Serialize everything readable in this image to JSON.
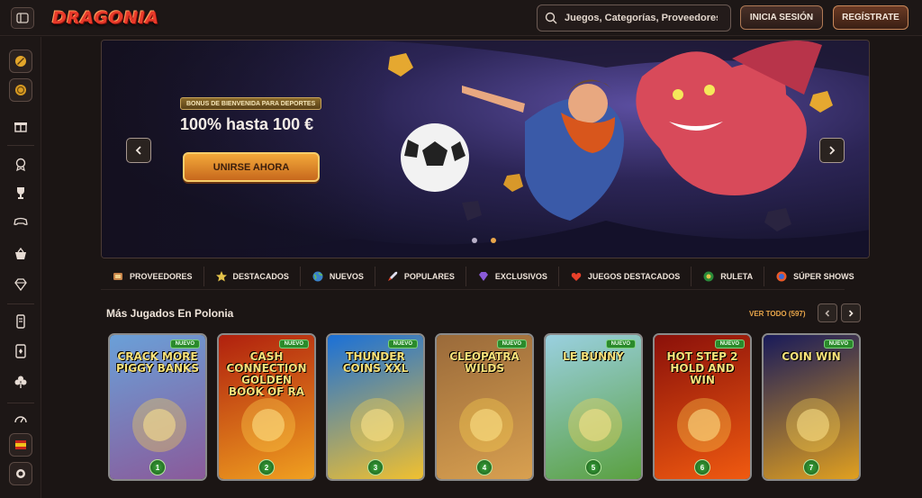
{
  "header": {
    "logo_text": "DRAGONIA",
    "search_placeholder": "Juegos, Categorías, Proveedores",
    "login_label": "INICIA SESIÓN",
    "register_label": "REGÍSTRATE"
  },
  "sidebar": {
    "icons": [
      "menu-icon",
      "rocket-icon",
      "coin-icon",
      "gift-icon",
      "medal-icon",
      "trophy-icon",
      "controller-icon",
      "basket-icon",
      "diamond-icon",
      "phone-icon",
      "card-icon",
      "clover-icon",
      "speed-icon",
      "flag-es-icon",
      "chip-icon"
    ]
  },
  "hero": {
    "tag": "BONUS DE BIENVENIDA PARA DEPORTES",
    "title": "100% hasta 100 €",
    "cta": "UNIRSE AHORA",
    "slides_total": 2,
    "active_slide": 1
  },
  "categories": [
    {
      "label": "PROVEEDORES",
      "icon": "providers-icon"
    },
    {
      "label": "DESTACADOS",
      "icon": "star-icon"
    },
    {
      "label": "NUEVOS",
      "icon": "globe-icon"
    },
    {
      "label": "POPULARES",
      "icon": "rocket-icon"
    },
    {
      "label": "EXCLUSIVOS",
      "icon": "gem-icon"
    },
    {
      "label": "JUEGOS DESTACADOS",
      "icon": "heart-icon"
    },
    {
      "label": "RULETA",
      "icon": "roulette-icon"
    },
    {
      "label": "SÚPER SHOWS",
      "icon": "show-icon"
    }
  ],
  "section": {
    "title": "Más Jugados En Polonia",
    "see_all": "VER TODO (597)"
  },
  "games": [
    {
      "title": "CRACK MORE PIGGY BANKS",
      "rank": "1",
      "badge": "NUEVO",
      "colors": [
        "#6aa0d8",
        "#8a5a9a"
      ]
    },
    {
      "title": "CASH CONNECTION GOLDEN BOOK OF RA",
      "rank": "2",
      "badge": "NUEVO",
      "colors": [
        "#b0200e",
        "#f0a020"
      ]
    },
    {
      "title": "THUNDER COINS XXL",
      "rank": "3",
      "badge": "NUEVO",
      "colors": [
        "#1a70d8",
        "#f0c030"
      ]
    },
    {
      "title": "CLEOPATRA WILDS",
      "rank": "4",
      "badge": "NUEVO",
      "colors": [
        "#9a6a3a",
        "#d8a050"
      ]
    },
    {
      "title": "LE BUNNY",
      "rank": "5",
      "badge": "NUEVO",
      "colors": [
        "#9ad0e0",
        "#5aa040"
      ]
    },
    {
      "title": "HOT STEP 2 HOLD AND WIN",
      "rank": "6",
      "badge": "NUEVO",
      "colors": [
        "#8a100a",
        "#f05a10"
      ]
    },
    {
      "title": "COIN WIN",
      "rank": "7",
      "badge": "NUEVO",
      "colors": [
        "#181a5a",
        "#e0a020"
      ]
    }
  ],
  "colors": {
    "accent": "#e9a64a",
    "new_badge": "#2b8a2b"
  }
}
